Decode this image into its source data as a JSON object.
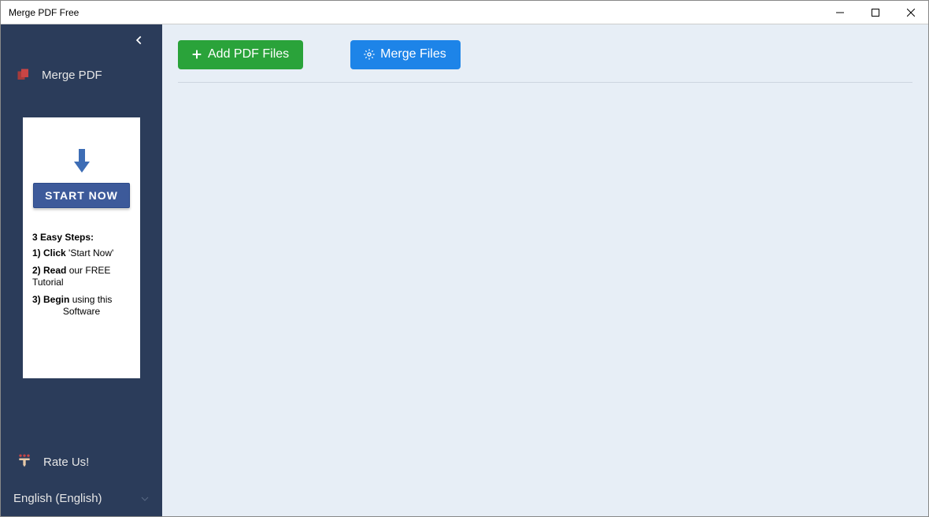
{
  "window": {
    "title": "Merge PDF Free"
  },
  "sidebar": {
    "nav": {
      "merge_pdf_label": "Merge PDF"
    },
    "promo": {
      "start_now_label": "START NOW",
      "steps_title": "3 Easy Steps:",
      "step1_num": "1)",
      "step1_bold": "Click",
      "step1_rest": " 'Start Now'",
      "step2_num": "2)",
      "step2_bold": "Read",
      "step2_rest": " our FREE Tutorial",
      "step3_num": "3)",
      "step3_bold": "Begin",
      "step3_rest": " using this",
      "step3_line2": "Software"
    },
    "rate_us_label": "Rate Us!",
    "language_label": "English (English)"
  },
  "toolbar": {
    "add_pdf_label": "Add PDF Files",
    "merge_files_label": "Merge Files"
  }
}
